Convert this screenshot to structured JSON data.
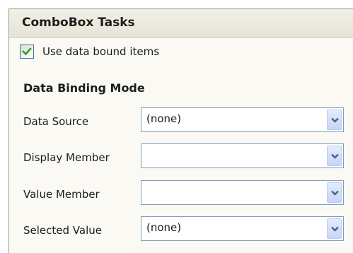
{
  "panel": {
    "title": "ComboBox Tasks",
    "use_data_bound": {
      "label": "Use data bound items",
      "checked": true
    },
    "section_title": "Data Binding Mode",
    "fields": [
      {
        "label": "Data Source",
        "value": "(none)"
      },
      {
        "label": "Display Member",
        "value": ""
      },
      {
        "label": "Value Member",
        "value": ""
      },
      {
        "label": "Selected Value",
        "value": "(none)"
      }
    ]
  },
  "icons": {
    "checkmark": "check-icon",
    "dropdown": "chevron-down-icon"
  },
  "colors": {
    "check": "#2e9e2e",
    "dropdown_arrow": "#4d6185",
    "combo_border": "#7f9db9"
  }
}
